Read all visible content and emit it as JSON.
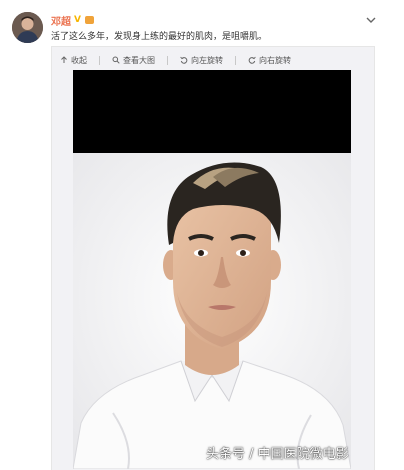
{
  "post": {
    "username": "邓超",
    "verified_mark": "V",
    "text": "活了这么多年，发现身上练的最好的肌肉，是咀嚼肌。"
  },
  "toolbar": {
    "collapse_label": "收起",
    "view_large_label": "查看大图",
    "rotate_left_label": "向左旋转",
    "rotate_right_label": "向右旋转"
  },
  "watermark": "头条号 / 中国医院微电影",
  "colors": {
    "username": "#eb7350",
    "verified": "#f7b500"
  },
  "icons": [
    "chevron-down-icon",
    "collapse-arrow-icon",
    "magnifier-icon",
    "rotate-left-icon",
    "rotate-right-icon"
  ]
}
